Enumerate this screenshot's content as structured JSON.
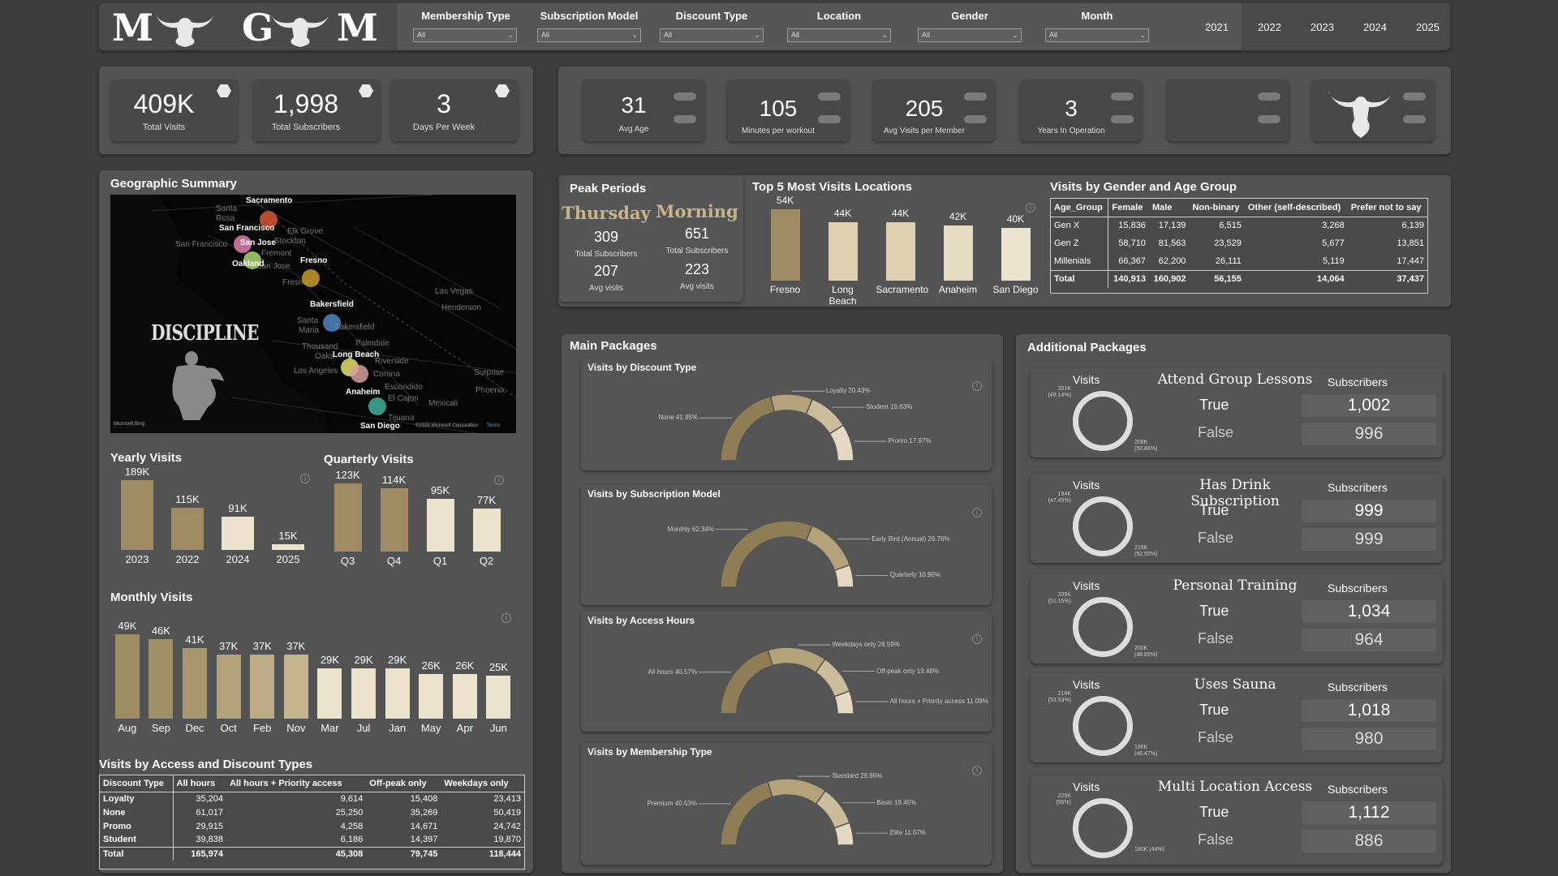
{
  "header": {
    "logo_text": "MGM",
    "filters": [
      {
        "label": "Membership Type",
        "value": "All"
      },
      {
        "label": "Subscription Model",
        "value": "All"
      },
      {
        "label": "Discount Type",
        "value": "All"
      },
      {
        "label": "Location",
        "value": "All"
      },
      {
        "label": "Gender",
        "value": "All"
      },
      {
        "label": "Month",
        "value": "All"
      }
    ],
    "years": [
      "2021",
      "2022",
      "2023",
      "2024",
      "2025"
    ]
  },
  "kpis_left": [
    {
      "value": "409K",
      "label": "Total Visits"
    },
    {
      "value": "1,998",
      "label": "Total Subscribers"
    },
    {
      "value": "3",
      "label": "Days Per Week"
    }
  ],
  "kpis_right": [
    {
      "value": "31",
      "label": "Avg Age"
    },
    {
      "value": "105",
      "label": "Minutes per workout"
    },
    {
      "value": "205",
      "label": "Avg Visits per Member"
    },
    {
      "value": "3",
      "label": "Years In Operation"
    }
  ],
  "geo": {
    "title": "Geographic Summary",
    "logo_text": "DISCIPLINE",
    "cities": [
      "Sacramento",
      "San Francisco",
      "San Jose",
      "Oakland",
      "Fresno",
      "Bakersfield",
      "Long Beach",
      "Anaheim",
      "San Diego"
    ],
    "faint": [
      "Santa",
      "Rosa",
      "Elk Grove",
      "San Francisco",
      "Stockton",
      "Fremont",
      "San Jose",
      "Fresno",
      "Las Vegas",
      "Henderson",
      "Santa",
      "Maria",
      "Bakersfield",
      "Thousand",
      "Oaks",
      "Palmdale",
      "Riverside",
      "Los Angeles",
      "Corona",
      "Escondido",
      "El Cajon",
      "Mexicali",
      "Tijuana",
      "Surprise",
      "Phoenix"
    ],
    "attribution_left": "Microsoft Bing",
    "attribution_right": "©2025 Microsoft Corporation",
    "terms": "Terms",
    "dot_colors": [
      "#d9573b",
      "#e07fb0",
      "#a8d870",
      "#c49c2a",
      "#4f86c0",
      "#e8e070",
      "#d8a0a0",
      "#40b0a0"
    ]
  },
  "yearly": {
    "title": "Yearly Visits",
    "chart_data": {
      "type": "bar",
      "categories": [
        "2023",
        "2022",
        "2024",
        "2025"
      ],
      "values": [
        189,
        115,
        91,
        15
      ],
      "labels": [
        "189K",
        "115K",
        "91K",
        "15K"
      ],
      "colors": [
        "#9e8b63",
        "#9e8b63",
        "#ece3cc",
        "#ece3cc"
      ]
    }
  },
  "quarterly": {
    "title": "Quarterly Visits",
    "chart_data": {
      "type": "bar",
      "categories": [
        "Q3",
        "Q4",
        "Q1",
        "Q2"
      ],
      "values": [
        123,
        114,
        95,
        77
      ],
      "labels": [
        "123K",
        "114K",
        "95K",
        "77K"
      ],
      "colors": [
        "#9e8b63",
        "#9e8b63",
        "#ece3cc",
        "#ece3cc"
      ]
    }
  },
  "monthly": {
    "title": "Monthly Visits",
    "chart_data": {
      "type": "bar",
      "categories": [
        "Aug",
        "Sep",
        "Dec",
        "Oct",
        "Feb",
        "Nov",
        "Mar",
        "Jul",
        "Jan",
        "May",
        "Apr",
        "Jun"
      ],
      "values": [
        49,
        46,
        41,
        37,
        37,
        37,
        29,
        29,
        29,
        26,
        26,
        25
      ],
      "labels": [
        "49K",
        "46K",
        "41K",
        "37K",
        "37K",
        "37K",
        "29K",
        "29K",
        "29K",
        "26K",
        "26K",
        "25K"
      ],
      "colors": [
        "#9e8b63",
        "#a08e66",
        "#a8966e",
        "#b3a27a",
        "#bcab84",
        "#c5b58f",
        "#ece3cc",
        "#ece3cc",
        "#ece3cc",
        "#ece3cc",
        "#ece3cc",
        "#ece3cc"
      ]
    }
  },
  "access_discount": {
    "title": "Visits by Access and Discount Types",
    "headers": [
      "Discount Type",
      "All hours",
      "All hours + Priority access",
      "Off-peak only",
      "Weekdays only"
    ],
    "rows": [
      [
        "Loyalty",
        "35,204",
        "9,614",
        "15,408",
        "23,413"
      ],
      [
        "None",
        "61,017",
        "25,250",
        "35,269",
        "50,419"
      ],
      [
        "Promo",
        "29,915",
        "4,258",
        "14,671",
        "24,742"
      ],
      [
        "Student",
        "39,838",
        "6,186",
        "14,397",
        "19,870"
      ],
      [
        "Total",
        "165,974",
        "45,308",
        "79,745",
        "118,444"
      ]
    ]
  },
  "peak": {
    "title": "Peak Periods",
    "day": {
      "name": "Thursday",
      "subs": "309",
      "subs_label": "Total Subscribers",
      "visits": "207",
      "visits_label": "Avg visits"
    },
    "time": {
      "name": "Morning",
      "subs": "651",
      "subs_label": "Total Subscribers",
      "visits": "223",
      "visits_label": "Avg visits"
    }
  },
  "top5": {
    "title": "Top 5 Most Visits Locations",
    "chart_data": {
      "type": "bar",
      "categories": [
        "Fresno",
        "Long Beach",
        "Sacramento",
        "Anaheim",
        "San Diego"
      ],
      "values": [
        54,
        44,
        44,
        42,
        40
      ],
      "labels": [
        "54K",
        "44K",
        "44K",
        "42K",
        "40K"
      ],
      "colors": [
        "#9e8b63",
        "#ddd0b0",
        "#ddd0b0",
        "#e6dcc2",
        "#ece3cc"
      ]
    }
  },
  "gender_age": {
    "title": "Visits by Gender and Age Group",
    "headers": [
      "Age_Group",
      "Female",
      "Male",
      "Non-binary",
      "Other (self-described)",
      "Prefer not to say"
    ],
    "rows": [
      [
        "Gen X",
        "15,836",
        "17,139",
        "6,515",
        "3,268",
        "6,139"
      ],
      [
        "Gen Z",
        "58,710",
        "81,563",
        "23,529",
        "5,677",
        "13,851"
      ],
      [
        "Millenials",
        "66,367",
        "62,200",
        "26,111",
        "5,119",
        "17,447"
      ],
      [
        "Total",
        "140,913",
        "160,902",
        "56,155",
        "14,064",
        "37,437"
      ]
    ]
  },
  "main_packages": {
    "title": "Main Packages",
    "charts": [
      {
        "title": "Visits by Discount Type",
        "chart_data": {
          "type": "pie",
          "labels": [
            "None",
            "Loyalty",
            "Student",
            "Promo"
          ],
          "values": [
            41.95,
            20.43,
            19.63,
            17.97
          ],
          "colors": [
            "#8f7d56",
            "#b3a27a",
            "#cbbd9b",
            "#e3d9c2"
          ]
        },
        "label_texts": [
          "None 41.95%",
          "Loyalty 20.43%",
          "Student 19.63%",
          "Promo 17.97%"
        ]
      },
      {
        "title": "Visits by Subscription Model",
        "chart_data": {
          "type": "pie",
          "labels": [
            "Monthly",
            "Early Bird (Annual)",
            "Quarterly"
          ],
          "values": [
            62.34,
            26.76,
            10.9
          ],
          "colors": [
            "#8f7d56",
            "#b3a27a",
            "#e3d9c2"
          ]
        },
        "label_texts": [
          "Monthly 62.34%",
          "Early Bird (Annual) 26.76%",
          "Quarterly 10.90%"
        ]
      },
      {
        "title": "Visits by Access Hours",
        "chart_data": {
          "type": "pie",
          "labels": [
            "All hours",
            "Weekdays only",
            "Off-peak only",
            "All hours + Priority access"
          ],
          "values": [
            40.57,
            28.59,
            19.48,
            11.09
          ],
          "colors": [
            "#8f7d56",
            "#b3a27a",
            "#cbbd9b",
            "#e3d9c2"
          ]
        },
        "label_texts": [
          "All hours 40.57%",
          "Weekdays only 28.59%",
          "Off-peak only 19.48%",
          "All hours + Priority access 11.09%"
        ]
      },
      {
        "title": "Visits by Membership Type",
        "chart_data": {
          "type": "pie",
          "labels": [
            "Premium",
            "Standard",
            "Basic",
            "Elite"
          ],
          "values": [
            40.53,
            28.95,
            19.45,
            11.07
          ],
          "colors": [
            "#8f7d56",
            "#b3a27a",
            "#cbbd9b",
            "#e3d9c2"
          ]
        },
        "label_texts": [
          "Premium 40.53%",
          "Standard 28.95%",
          "Basic 19.45%",
          "Elite 11.07%"
        ]
      }
    ]
  },
  "additional_packages": {
    "title": "Additional Packages",
    "visits_label": "Visits",
    "subscribers_label": "Subscribers",
    "true_label": "True",
    "false_label": "False",
    "items": [
      {
        "title": "Attend Group Lessons",
        "true_subs": "1,002",
        "false_subs": "996",
        "donut_top": "201K (49.14%)",
        "donut_bottom": "208K (50.86%)",
        "chart_data": {
          "type": "pie",
          "labels": [
            "True",
            "False"
          ],
          "values": [
            49.14,
            50.86
          ]
        }
      },
      {
        "title": "Has Drink Subscription",
        "true_subs": "999",
        "false_subs": "999",
        "donut_top": "194K (47.45%)",
        "donut_bottom": "215K (52.55%)",
        "chart_data": {
          "type": "pie",
          "labels": [
            "True",
            "False"
          ],
          "values": [
            47.45,
            52.55
          ]
        }
      },
      {
        "title": "Personal Training",
        "true_subs": "1,034",
        "false_subs": "964",
        "donut_top": "209K (51.15%)",
        "donut_bottom": "200K (48.85%)",
        "chart_data": {
          "type": "pie",
          "labels": [
            "True",
            "False"
          ],
          "values": [
            51.15,
            48.85
          ]
        }
      },
      {
        "title": "Uses Sauna",
        "true_subs": "1,018",
        "false_subs": "980",
        "donut_top": "219K (53.53%)",
        "donut_bottom": "190K (46.47%)",
        "chart_data": {
          "type": "pie",
          "labels": [
            "True",
            "False"
          ],
          "values": [
            53.53,
            46.47
          ]
        }
      },
      {
        "title": "Multi Location Access",
        "true_subs": "1,112",
        "false_subs": "886",
        "donut_top": "229K (56%)",
        "donut_bottom": "180K (44%)",
        "chart_data": {
          "type": "pie",
          "labels": [
            "True",
            "False"
          ],
          "values": [
            56,
            44
          ]
        }
      }
    ]
  }
}
